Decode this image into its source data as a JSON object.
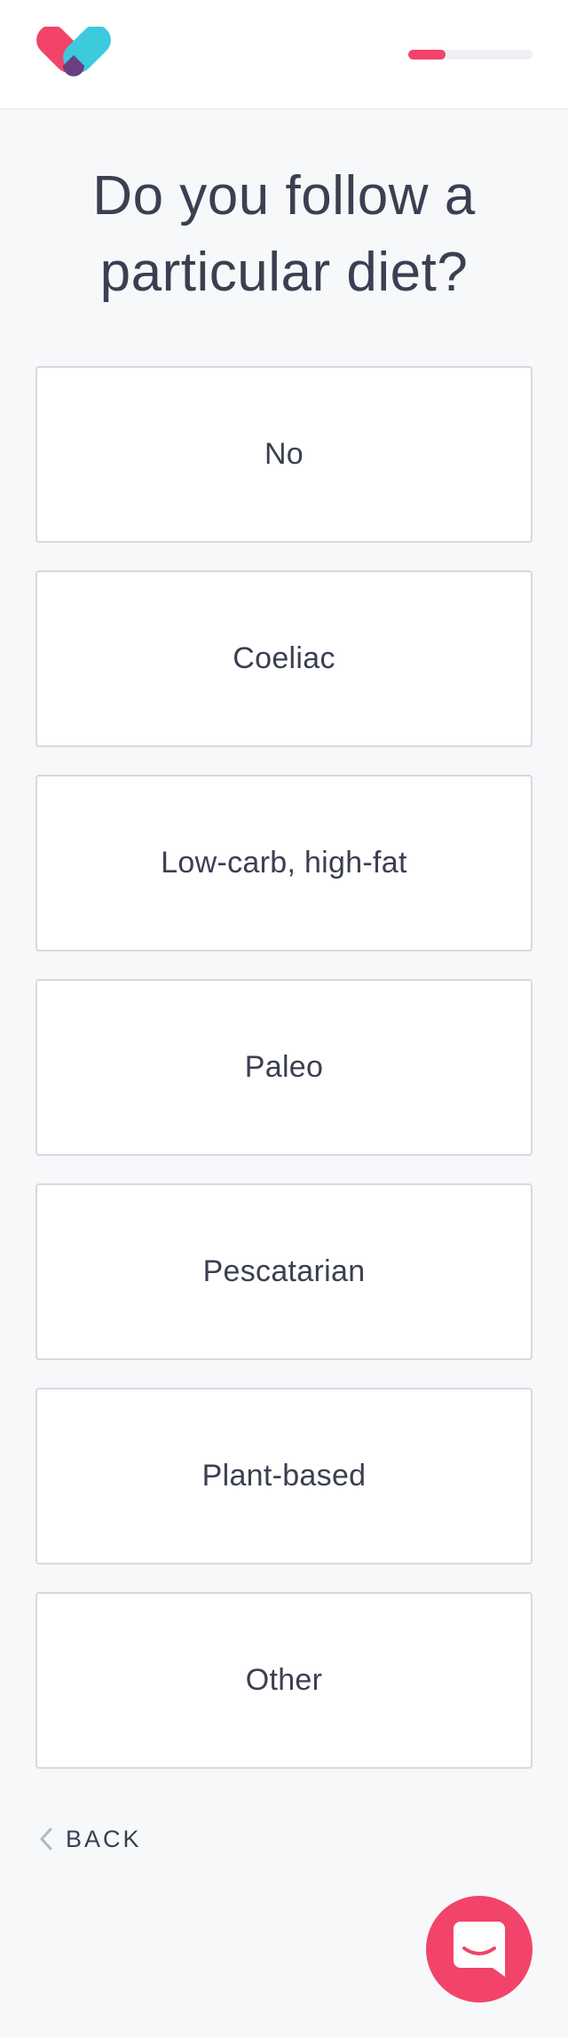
{
  "header": {
    "logo_icon": "heart-pill-logo-icon",
    "progress_fraction": 0.3,
    "colors": {
      "accent": "#f2436a",
      "teal": "#3ccbdc",
      "purple": "#6a3f82"
    }
  },
  "question": {
    "title": "Do you follow a particular diet?"
  },
  "options": [
    {
      "label": "No"
    },
    {
      "label": "Coeliac"
    },
    {
      "label": "Low-carb, high-fat"
    },
    {
      "label": "Paleo"
    },
    {
      "label": "Pescatarian"
    },
    {
      "label": "Plant-based"
    },
    {
      "label": "Other"
    }
  ],
  "footer": {
    "back_label": "BACK",
    "back_icon": "chevron-left-icon",
    "chat_icon": "chat-bubble-icon"
  }
}
